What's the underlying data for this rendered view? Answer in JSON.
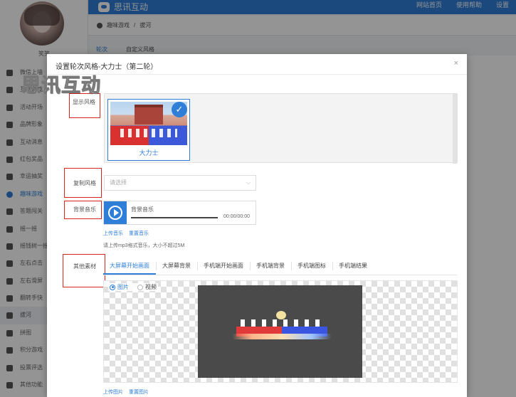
{
  "app": {
    "brand": "思讯互动",
    "top_nav": [
      "网站首页",
      "使用帮助",
      "设置"
    ],
    "username": "笑笑"
  },
  "sidebar": {
    "items": [
      {
        "label": "微信上墙",
        "state": ""
      },
      {
        "label": "互动游戏",
        "state": ""
      },
      {
        "label": "活动开场",
        "state": ""
      },
      {
        "label": "品牌形象",
        "state": ""
      },
      {
        "label": "互动消息",
        "state": ""
      },
      {
        "label": "红包奖品",
        "state": ""
      },
      {
        "label": "幸运抽奖",
        "state": ""
      },
      {
        "label": "趣味游戏",
        "state": "active"
      },
      {
        "label": "答题闯关",
        "state": ""
      },
      {
        "label": "摇一摇",
        "state": ""
      },
      {
        "label": "摇钱树一摇",
        "state": ""
      },
      {
        "label": "左右点击",
        "state": ""
      },
      {
        "label": "左右滑屏",
        "state": ""
      },
      {
        "label": "翻转手快",
        "state": ""
      },
      {
        "label": "拔河",
        "state": "current"
      },
      {
        "label": "拼图",
        "state": ""
      },
      {
        "label": "积分游戏",
        "state": ""
      },
      {
        "label": "投票评选",
        "state": ""
      },
      {
        "label": "其他功能",
        "state": ""
      }
    ]
  },
  "breadcrumb": {
    "parent": "趣味游戏",
    "separator": "/",
    "current": "拔河"
  },
  "background_tabs": [
    "轮次",
    "自定义风格"
  ],
  "modal": {
    "title": "设置轮次风格-大力士（第二轮）",
    "close_icon": "×",
    "watermark": "思讯互动",
    "display_style": {
      "label": "显示风格",
      "cards": [
        {
          "name": "大力士",
          "selected": true
        }
      ]
    },
    "copy_style": {
      "label": "复制风格",
      "placeholder": "请选择"
    },
    "music": {
      "label": "背景音乐",
      "title": "背景音乐",
      "time": "00:00/00:00",
      "upload_link": "上传音乐",
      "reset_link": "重置音乐",
      "hint": "请上传mp3格式音乐，大小不超过5M"
    },
    "materials": {
      "label": "其他素材",
      "tabs": [
        "大屏幕开始画面",
        "大屏幕背景",
        "手机端开始画面",
        "手机端背景",
        "手机端图标",
        "手机端结果"
      ],
      "active_tab": 0,
      "types": [
        {
          "label": "图片",
          "selected": true
        },
        {
          "label": "视频",
          "selected": false
        }
      ],
      "upload_link": "上传图片",
      "reset_link": "重置图片"
    }
  },
  "colors": {
    "accent": "#2f7fd8",
    "annotation": "#d9271d"
  }
}
